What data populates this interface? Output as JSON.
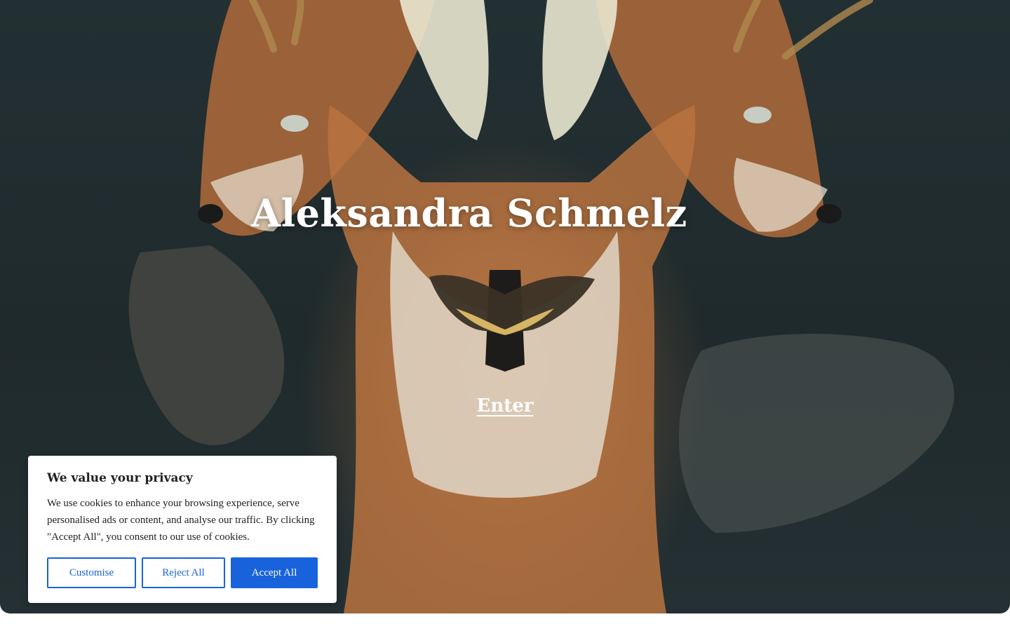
{
  "hero": {
    "title": "Aleksandra Schmelz",
    "enter_label": "Enter",
    "image": "fox-taxidermy-artwork"
  },
  "cookie_banner": {
    "title": "We value your privacy",
    "text": "We use cookies to enhance your browsing experience, serve personalised ads or content, and analyse our traffic. By clicking \"Accept All\", you consent to our use of cookies.",
    "buttons": {
      "customise": "Customise",
      "reject": "Reject All",
      "accept": "Accept All"
    },
    "accent_color": "#1863dc"
  }
}
